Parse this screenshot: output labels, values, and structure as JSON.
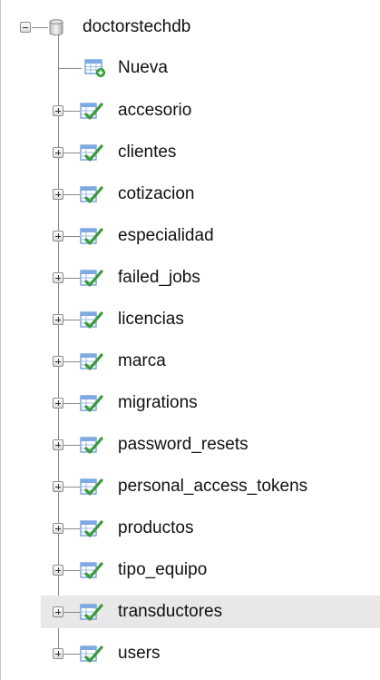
{
  "database": {
    "name": "doctorstechdb",
    "icon": "database-icon"
  },
  "new_item": {
    "label": "Nueva",
    "icon": "new-table-icon"
  },
  "tables": [
    {
      "name": "accesorio"
    },
    {
      "name": "clientes"
    },
    {
      "name": "cotizacion"
    },
    {
      "name": "especialidad"
    },
    {
      "name": "failed_jobs"
    },
    {
      "name": "licencias"
    },
    {
      "name": "marca"
    },
    {
      "name": "migrations"
    },
    {
      "name": "password_resets"
    },
    {
      "name": "personal_access_tokens"
    },
    {
      "name": "productos"
    },
    {
      "name": "tipo_equipo"
    },
    {
      "name": "transductores"
    },
    {
      "name": "users"
    }
  ],
  "table_icon": "table-icon",
  "highlighted_table": "transductores",
  "colors": {
    "highlight_bg": "#e8e8e8",
    "tree_line": "#8a8a8a",
    "text": "#111111",
    "table_icon_green": "#3a9a3a",
    "table_icon_blue": "#5b8fd6"
  }
}
